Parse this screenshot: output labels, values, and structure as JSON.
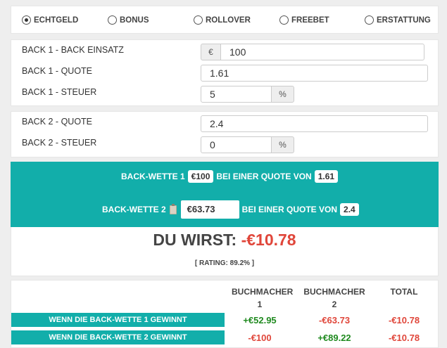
{
  "modes": [
    {
      "label": "ECHTGELD",
      "selected": true
    },
    {
      "label": "BONUS",
      "selected": false
    },
    {
      "label": "ROLLOVER",
      "selected": false
    },
    {
      "label": "FREEBET",
      "selected": false
    },
    {
      "label": "ERSTATTUNG",
      "selected": false
    }
  ],
  "back1": {
    "stake_label": "BACK 1 - BACK EINSATZ",
    "currency": "€",
    "stake": "100",
    "odds_label": "BACK 1 - QUOTE",
    "odds": "1.61",
    "tax_label": "BACK 1 - STEUER",
    "tax": "5",
    "percent": "%"
  },
  "back2": {
    "odds_label": "BACK 2 - QUOTE",
    "odds": "2.4",
    "tax_label": "BACK 2 - STEUER",
    "tax": "0",
    "percent": "%"
  },
  "summary": {
    "line1_prefix": "BACK-WETTE 1",
    "line1_stake": "€100",
    "line1_mid": "BEI EINER QUOTE VON",
    "line1_odds": "1.61",
    "line2_prefix": "BACK-WETTE 2",
    "line2_stake": "€63.73",
    "line2_mid": "BEI EINER QUOTE VON",
    "line2_odds": "2.4",
    "result_prefix": "DU WIRST:",
    "result_value": "-€10.78",
    "rating": "[ RATING: 89.2% ]"
  },
  "table": {
    "headers": [
      "BUCHMACHER\n1",
      "BUCHMACHER\n2",
      "TOTAL"
    ],
    "rows": [
      {
        "label": "WENN DIE BACK-WETTE 1 GEWINNT",
        "b1": "+€52.95",
        "b2": "-€63.73",
        "total": "-€10.78"
      },
      {
        "label": "WENN DIE BACK-WETTE 2 GEWINNT",
        "b1": "-€100",
        "b2": "+€89.22",
        "total": "-€10.78"
      }
    ]
  },
  "colors": {
    "accent": "#12aeaa",
    "negative": "#e0463a",
    "positive": "#1f8a1f"
  }
}
